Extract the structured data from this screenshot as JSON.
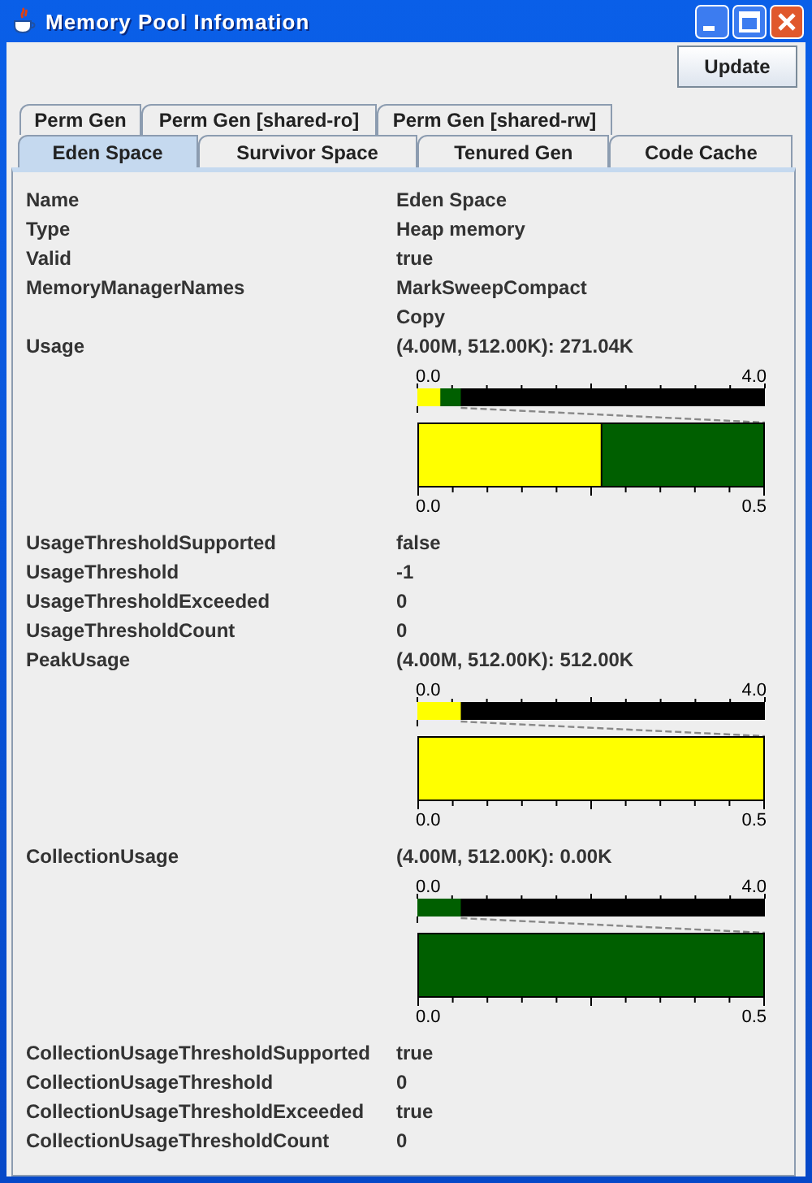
{
  "window": {
    "title": "Memory Pool Infomation"
  },
  "update_button": "Update",
  "tab_rows": [
    {
      "tabs": [
        {
          "label": "Perm Gen",
          "selected": false
        },
        {
          "label": "Perm Gen [shared-ro]",
          "selected": false
        },
        {
          "label": "Perm Gen [shared-rw]",
          "selected": false
        }
      ]
    },
    {
      "tabs": [
        {
          "label": "Eden Space",
          "selected": true
        },
        {
          "label": "Survivor Space",
          "selected": false
        },
        {
          "label": "Tenured Gen",
          "selected": false
        },
        {
          "label": "Code Cache",
          "selected": false
        }
      ]
    }
  ],
  "rows": [
    {
      "name": "Name",
      "values": [
        "Eden Space"
      ]
    },
    {
      "name": "Type",
      "values": [
        "Heap memory"
      ]
    },
    {
      "name": "Valid",
      "values": [
        "true"
      ]
    },
    {
      "name": "MemoryManagerNames",
      "values": [
        "MarkSweepCompact",
        "Copy"
      ]
    },
    {
      "name": "Usage",
      "values": [
        "(4.00M, 512.00K): 271.04K"
      ],
      "gauge": {
        "overview": {
          "min_label": "0.0",
          "max_label": "4.0",
          "segments": [
            {
              "level": 0.066,
              "color": "#ffff00"
            },
            {
              "level": 0.125,
              "color": "#005f00"
            }
          ]
        },
        "detail": {
          "min_label": "0.0",
          "max_label": "0.5",
          "segments": [
            {
              "level": 0.53,
              "color": "#ffff00"
            },
            {
              "level": 1,
              "color": "#005f00"
            }
          ]
        }
      }
    },
    {
      "name": "UsageThresholdSupported",
      "values": [
        "false"
      ]
    },
    {
      "name": "UsageThreshold",
      "values": [
        "-1"
      ]
    },
    {
      "name": "UsageThresholdExceeded",
      "values": [
        "0"
      ]
    },
    {
      "name": "UsageThresholdCount",
      "values": [
        "0"
      ]
    },
    {
      "name": "PeakUsage",
      "values": [
        "(4.00M, 512.00K): 512.00K"
      ],
      "gauge": {
        "overview": {
          "min_label": "0.0",
          "max_label": "4.0",
          "segments": [
            {
              "level": 0.125,
              "color": "#ffff00"
            }
          ]
        },
        "detail": {
          "min_label": "0.0",
          "max_label": "0.5",
          "segments": [
            {
              "level": 1,
              "color": "#ffff00"
            }
          ]
        }
      }
    },
    {
      "name": "CollectionUsage",
      "values": [
        "(4.00M, 512.00K): 0.00K"
      ],
      "gauge": {
        "overview": {
          "min_label": "0.0",
          "max_label": "4.0",
          "segments": [
            {
              "level": 0.125,
              "color": "#005f00"
            }
          ]
        },
        "detail": {
          "min_label": "0.0",
          "max_label": "0.5",
          "segments": [
            {
              "level": 1,
              "color": "#005f00"
            }
          ]
        }
      }
    },
    {
      "name": "CollectionUsageThresholdSupported",
      "values": [
        "true"
      ]
    },
    {
      "name": "CollectionUsageThreshold",
      "values": [
        "0"
      ]
    },
    {
      "name": "CollectionUsageThresholdExceeded",
      "values": [
        "true"
      ]
    },
    {
      "name": "CollectionUsageThresholdCount",
      "values": [
        "0"
      ]
    }
  ]
}
